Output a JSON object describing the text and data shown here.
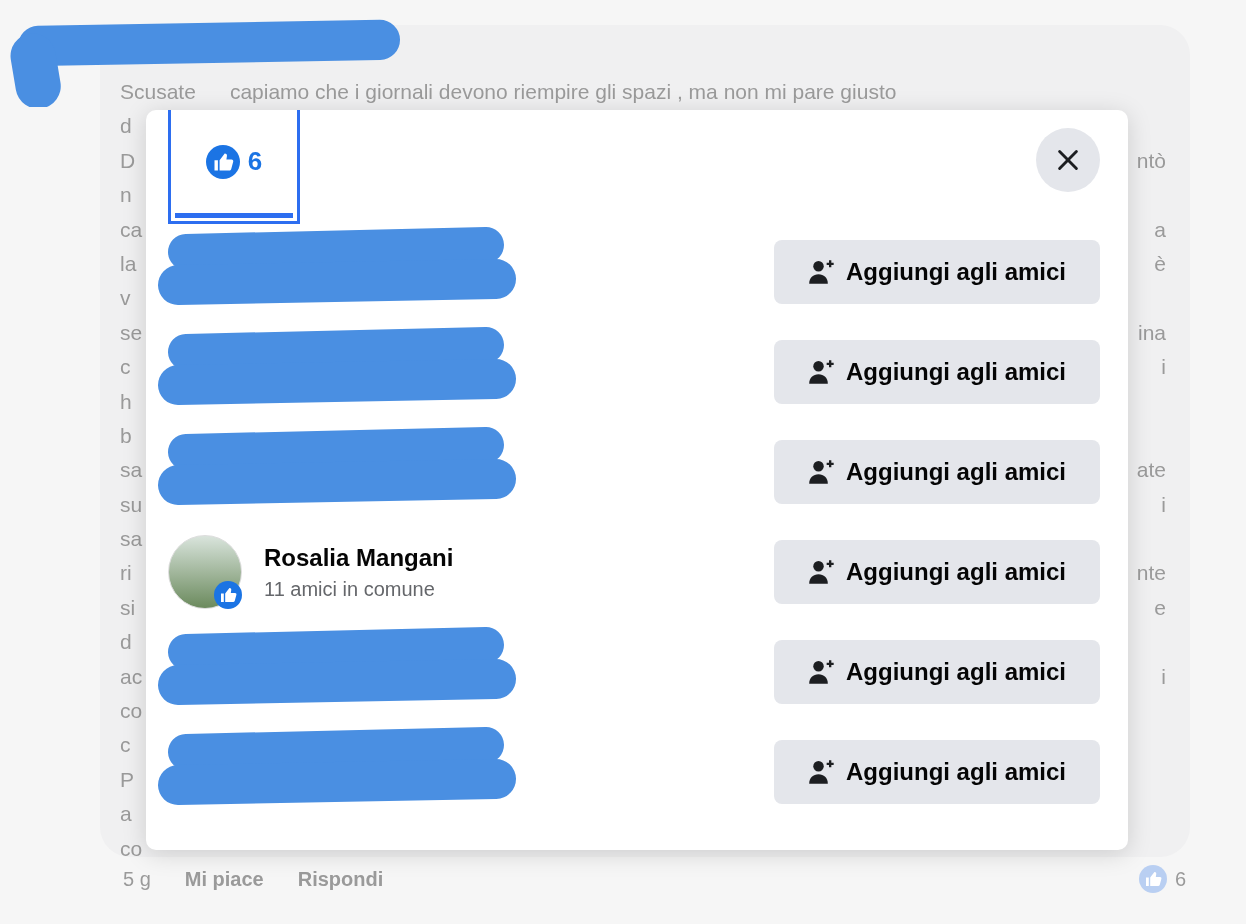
{
  "comment": {
    "first_line": [
      "Scusate",
      "capiamo che i giornali devono riempire gli spazi , ma non mi pare giusto"
    ],
    "lines": [
      {
        "left": "d"
      },
      {
        "left": "D",
        "right": "ntò"
      },
      {
        "left": "n"
      },
      {
        "left": "ca",
        "right": "a"
      },
      {
        "left": "la",
        "right": "è"
      },
      {
        "left": "v"
      },
      {
        "left": "se",
        "right": "ina"
      },
      {
        "left": "c",
        "right": "i"
      },
      {
        "left": "h"
      },
      {
        "left": "b"
      },
      {
        "left": "sa",
        "right": "ate"
      },
      {
        "left": "su",
        "right": "i"
      },
      {
        "left": "sa"
      },
      {
        "left": "ri",
        "right": "nte"
      },
      {
        "left": "si",
        "right": "e"
      },
      {
        "left": "d"
      },
      {
        "left": "ac",
        "right": "i"
      },
      {
        "left": "co"
      },
      {
        "left": "c"
      },
      {
        "left": "P"
      },
      {
        "left": "a"
      },
      {
        "left": "co"
      }
    ],
    "footer": {
      "time": "5 g",
      "actions": [
        "Mi piace",
        "Rispondi"
      ],
      "reaction_count": "6"
    }
  },
  "modal": {
    "tabs": [
      {
        "count": "6",
        "selected": true
      }
    ],
    "people": [
      {
        "redacted": true,
        "button": "Aggiungi agli amici"
      },
      {
        "redacted": true,
        "button": "Aggiungi agli amici"
      },
      {
        "redacted": true,
        "button": "Aggiungi agli amici"
      },
      {
        "redacted": false,
        "name": "Rosalia Mangani",
        "mutual_friends": "11 amici in comune",
        "button": "Aggiungi agli amici"
      },
      {
        "redacted": true,
        "button": "Aggiungi agli amici"
      },
      {
        "redacted": true,
        "button": "Aggiungi agli amici"
      }
    ]
  }
}
